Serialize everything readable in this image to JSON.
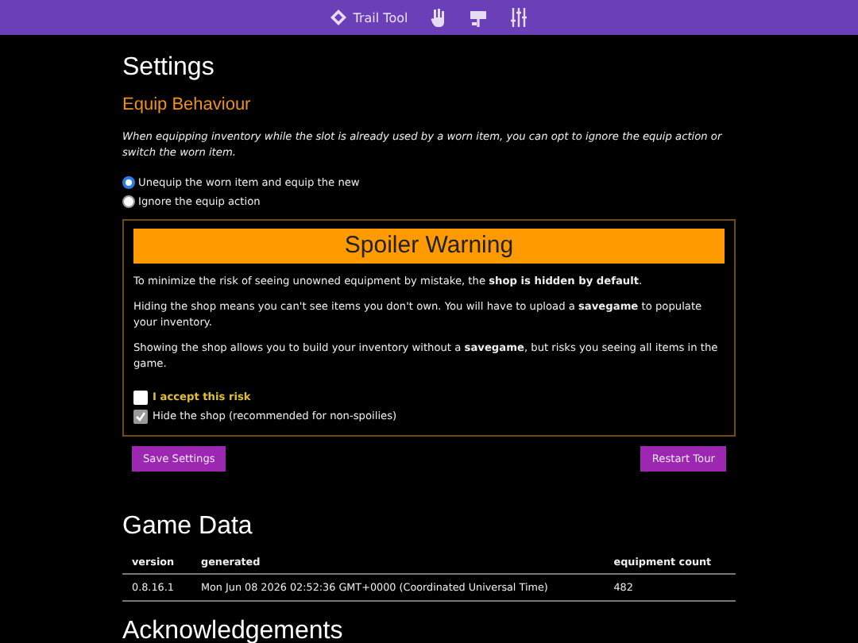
{
  "navbar": {
    "brand": "Trail Tool",
    "icons": [
      {
        "kind": "hand"
      },
      {
        "kind": "sign"
      },
      {
        "kind": "sliders"
      }
    ]
  },
  "title": "Settings",
  "equip": {
    "heading": "Equip Behaviour",
    "description": "When equipping inventory while the slot is already used by a worn item, you can opt to ignore the equip action or switch the worn item.",
    "options": [
      {
        "label": "Unequip the worn item and equip the new",
        "selected": true
      },
      {
        "label": "Ignore the equip action",
        "selected": false
      }
    ]
  },
  "spoiler": {
    "title": "Spoiler Warning",
    "paragraphs": [
      "To minimize the risk of seeing unowned equipment by mistake, the **shop is hidden by default**.",
      "Hiding the shop means you can't see items you don't own. You will have to upload a **savegame** to populate your inventory.",
      "Showing the shop allows you to build your inventory without a **savegame**, but risks you seeing all items in the game."
    ],
    "checks": [
      {
        "label": "I accept this risk",
        "checked": false,
        "disabled": false,
        "emphasis": true
      },
      {
        "label": "Hide the shop (recommended for non-spoilies)",
        "checked": true,
        "disabled": true,
        "emphasis": false
      }
    ]
  },
  "buttons": [
    "Save Settings",
    "Restart Tour"
  ],
  "game_data": {
    "heading": "Game Data",
    "columns": [
      "version",
      "generated",
      "equipment count"
    ],
    "rows": [
      [
        "0.8.16.1",
        "Mon Jun 08 2026 02:52:36 GMT+0000 (Coordinated Universal Time)",
        "482"
      ]
    ]
  },
  "next_heading": "Acknowledgements"
}
